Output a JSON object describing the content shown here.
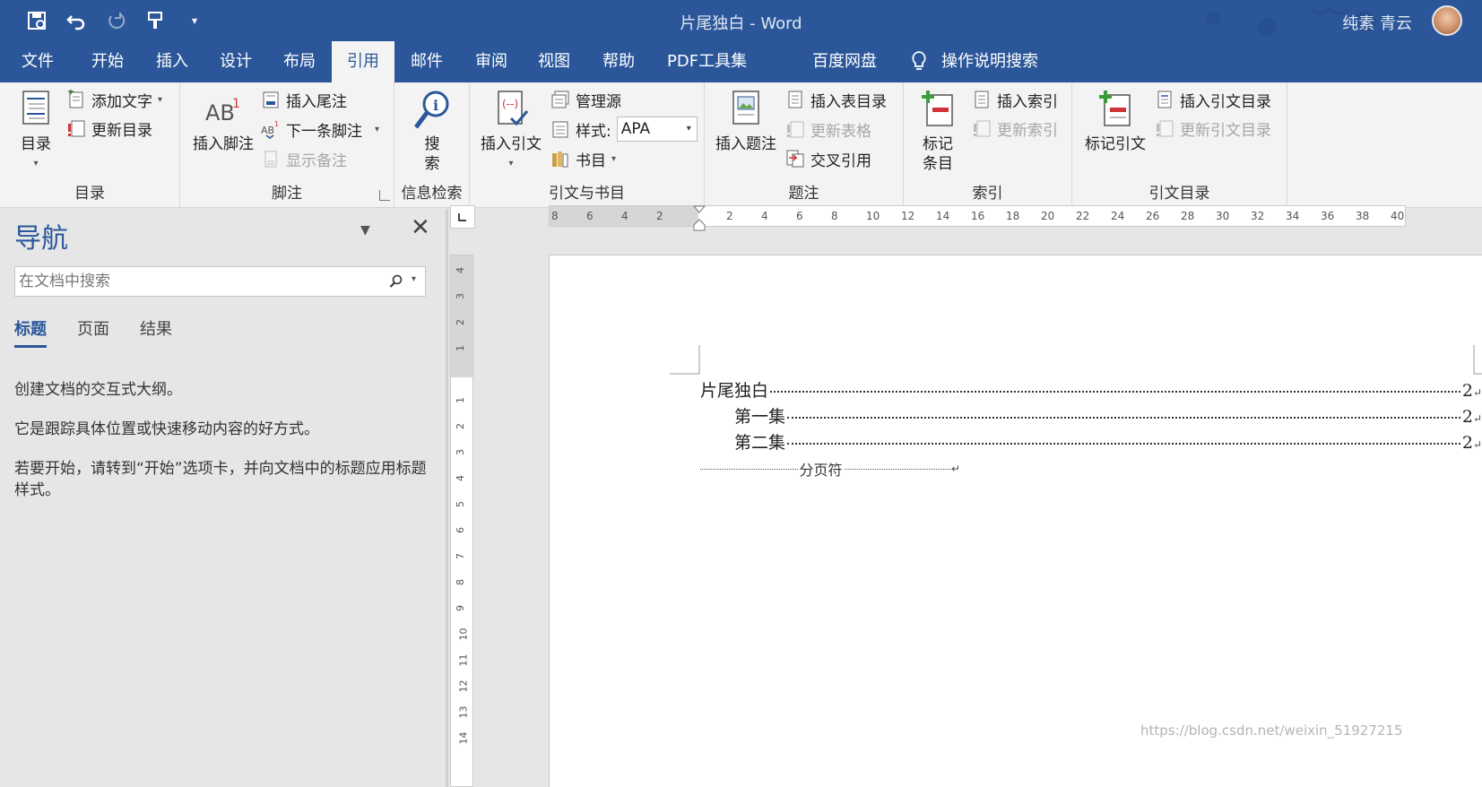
{
  "titlebar": {
    "title": "片尾独白  -  Word",
    "user": "纯素 青云"
  },
  "tabs": [
    {
      "label": "文件"
    },
    {
      "label": "开始"
    },
    {
      "label": "插入"
    },
    {
      "label": "设计"
    },
    {
      "label": "布局"
    },
    {
      "label": "引用"
    },
    {
      "label": "邮件"
    },
    {
      "label": "审阅"
    },
    {
      "label": "视图"
    },
    {
      "label": "帮助"
    },
    {
      "label": "PDF工具集"
    },
    {
      "label": "百度网盘"
    }
  ],
  "tell_me": "操作说明搜索",
  "ribbon": {
    "toc": {
      "group_label": "目录",
      "toc_button": "目录",
      "add_text": "添加文字",
      "update_toc": "更新目录"
    },
    "footnotes": {
      "group_label": "脚注",
      "insert_footnote": "插入脚注",
      "insert_endnote": "插入尾注",
      "next_footnote": "下一条脚注",
      "show_notes": "显示备注"
    },
    "research": {
      "group_label": "信息检索",
      "search_line1": "搜",
      "search_line2": "索"
    },
    "citations": {
      "group_label": "引文与书目",
      "insert_citation": "插入引文",
      "manage_sources": "管理源",
      "style_label": "样式:",
      "style_value": "APA",
      "bibliography": "书目"
    },
    "captions": {
      "group_label": "题注",
      "insert_caption": "插入题注",
      "insert_table_of_figures": "插入表目录",
      "update_table": "更新表格",
      "cross_reference": "交叉引用"
    },
    "index": {
      "group_label": "索引",
      "mark_entry_line1": "标记",
      "mark_entry_line2": "条目",
      "insert_index": "插入索引",
      "update_index": "更新索引"
    },
    "authorities": {
      "group_label": "引文目录",
      "mark_citation": "标记引文",
      "insert_table": "插入引文目录",
      "update_table": "更新引文目录"
    }
  },
  "nav": {
    "title": "导航",
    "search_placeholder": "在文档中搜索",
    "tabs": [
      "标题",
      "页面",
      "结果"
    ],
    "para1": "创建文档的交互式大纲。",
    "para2": "它是跟踪具体位置或快速移动内容的好方式。",
    "para3": "若要开始，请转到“开始”选项卡，并向文档中的标题应用标题样式。"
  },
  "hruler_labels": [
    "8",
    "6",
    "4",
    "2",
    "",
    "2",
    "4",
    "6",
    "8",
    "10",
    "12",
    "14",
    "16",
    "18",
    "20",
    "22",
    "24",
    "26",
    "28",
    "30",
    "32",
    "34",
    "36",
    "38",
    "40"
  ],
  "vruler_labels": [
    "4",
    "3",
    "2",
    "1",
    "",
    "1",
    "2",
    "3",
    "4",
    "5",
    "6",
    "7",
    "8",
    "9",
    "10",
    "11",
    "12",
    "13",
    "14"
  ],
  "document": {
    "toc": [
      {
        "text": "片尾独白",
        "page": "2"
      },
      {
        "text": "第一集",
        "page": "2"
      },
      {
        "text": "第二集",
        "page": "2"
      }
    ],
    "page_break": "分页符"
  },
  "watermark": "https://blog.csdn.net/weixin_51927215"
}
